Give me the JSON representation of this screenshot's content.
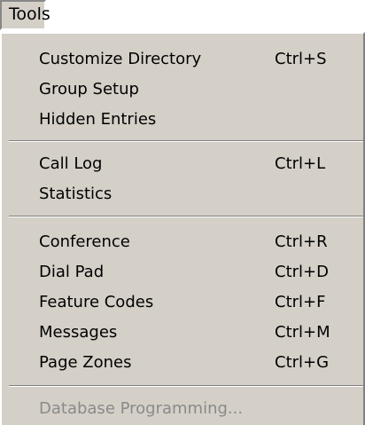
{
  "menubar": {
    "title": "Tools"
  },
  "menu": {
    "groups": [
      [
        {
          "label": "Customize Directory",
          "shortcut": "Ctrl+S"
        },
        {
          "label": "Group Setup",
          "shortcut": ""
        },
        {
          "label": "Hidden Entries",
          "shortcut": ""
        }
      ],
      [
        {
          "label": "Call Log",
          "shortcut": "Ctrl+L"
        },
        {
          "label": "Statistics",
          "shortcut": ""
        }
      ],
      [
        {
          "label": "Conference",
          "shortcut": "Ctrl+R"
        },
        {
          "label": "Dial Pad",
          "shortcut": "Ctrl+D"
        },
        {
          "label": "Feature Codes",
          "shortcut": "Ctrl+F"
        },
        {
          "label": "Messages",
          "shortcut": "Ctrl+M"
        },
        {
          "label": "Page Zones",
          "shortcut": "Ctrl+G"
        }
      ],
      [
        {
          "label": "Database Programming...",
          "shortcut": "",
          "disabled": true
        }
      ]
    ]
  },
  "colors": {
    "menu_background": "#d4d0c8",
    "disabled_text": "#8a8a8a",
    "text": "#000000"
  }
}
